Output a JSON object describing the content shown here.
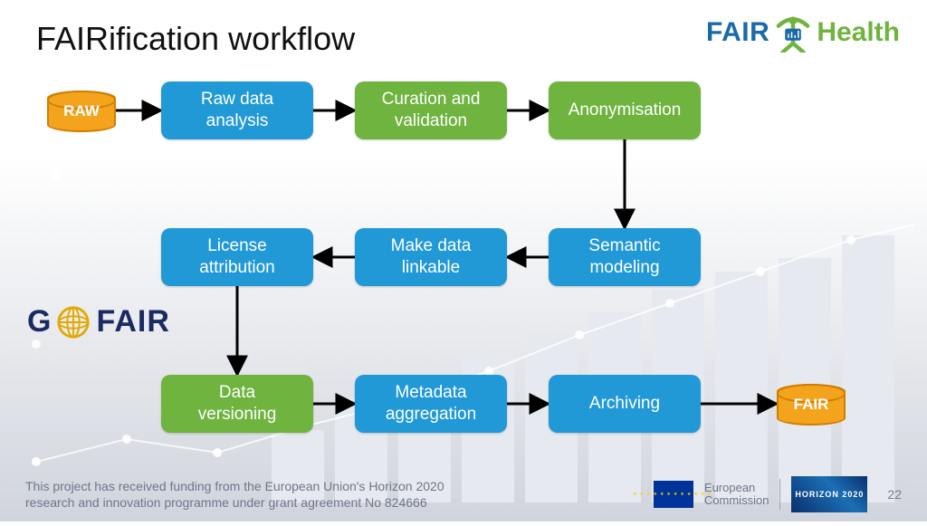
{
  "title": "FAIRification workflow",
  "cyl_start": "RAW",
  "cyl_end": "FAIR",
  "nodes": {
    "raw_analysis": "Raw data\nanalysis",
    "curation": "Curation and\nvalidation",
    "anonymisation": "Anonymisation",
    "semantic": "Semantic\nmodeling",
    "linkable": "Make data\nlinkable",
    "license": "License\nattribution",
    "versioning": "Data\nversioning",
    "metadata": "Metadata\naggregation",
    "archiving": "Archiving"
  },
  "logos": {
    "fair4health_fair": "FAIR",
    "fair4health_health": "Health",
    "gofair_g": "G",
    "gofair_fair": "FAIR"
  },
  "footer": {
    "ack": "This project has received funding from the European Union's Horizon 2020 research and innovation programme under grant agreement No 824666",
    "ec1": "European",
    "ec2": "Commission",
    "h2020": "HORIZON 2020",
    "page": "22"
  },
  "chart_data": {
    "type": "table",
    "description": "Directed workflow graph",
    "nodes": [
      {
        "id": "RAW",
        "label": "RAW",
        "kind": "cylinder",
        "color": "orange"
      },
      {
        "id": "A",
        "label": "Raw data analysis",
        "kind": "box",
        "color": "blue"
      },
      {
        "id": "B",
        "label": "Curation and validation",
        "kind": "box",
        "color": "green"
      },
      {
        "id": "C",
        "label": "Anonymisation",
        "kind": "box",
        "color": "green"
      },
      {
        "id": "D",
        "label": "Semantic modeling",
        "kind": "box",
        "color": "blue"
      },
      {
        "id": "E",
        "label": "Make data linkable",
        "kind": "box",
        "color": "blue"
      },
      {
        "id": "F",
        "label": "License attribution",
        "kind": "box",
        "color": "blue"
      },
      {
        "id": "G",
        "label": "Data versioning",
        "kind": "box",
        "color": "green"
      },
      {
        "id": "H",
        "label": "Metadata aggregation",
        "kind": "box",
        "color": "blue"
      },
      {
        "id": "I",
        "label": "Archiving",
        "kind": "box",
        "color": "blue"
      },
      {
        "id": "FAIR",
        "label": "FAIR",
        "kind": "cylinder",
        "color": "orange"
      }
    ],
    "edges": [
      [
        "RAW",
        "A"
      ],
      [
        "A",
        "B"
      ],
      [
        "B",
        "C"
      ],
      [
        "C",
        "D"
      ],
      [
        "D",
        "E"
      ],
      [
        "E",
        "F"
      ],
      [
        "F",
        "G"
      ],
      [
        "G",
        "H"
      ],
      [
        "H",
        "I"
      ],
      [
        "I",
        "FAIR"
      ]
    ]
  }
}
